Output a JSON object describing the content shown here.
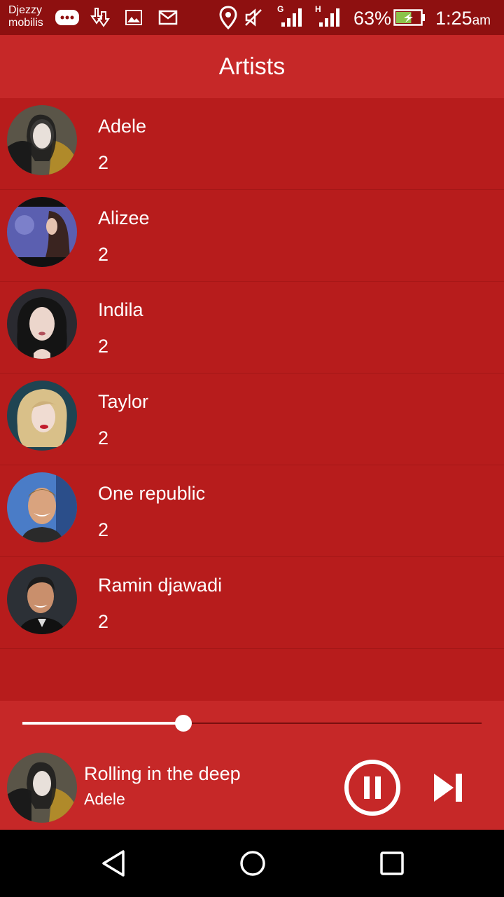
{
  "status_bar": {
    "carrier_line1": "Djezzy",
    "carrier_line2": "mobilis",
    "network_label_1": "G",
    "network_label_2": "H",
    "battery_percent": "63%",
    "time": "1:25",
    "time_suffix": "am",
    "battery_color": "#8bc34a",
    "icons": [
      "chat-icon",
      "download-icon",
      "image-icon",
      "email-icon",
      "location-icon",
      "mute-icon",
      "signal-icon",
      "signal-icon",
      "battery-charging-icon"
    ]
  },
  "app_bar": {
    "title": "Artists",
    "color": "#c62828"
  },
  "artists": [
    {
      "name": "Adele",
      "count": "2"
    },
    {
      "name": "Alizee",
      "count": "2"
    },
    {
      "name": "Indila",
      "count": "2"
    },
    {
      "name": "Taylor",
      "count": "2"
    },
    {
      "name": "One republic",
      "count": "2"
    },
    {
      "name": "Ramin djawadi",
      "count": "2"
    }
  ],
  "player": {
    "track_title": "Rolling in the deep",
    "track_artist": "Adele",
    "progress": 0.35,
    "state_icon": "pause-icon",
    "next_icon": "skip-next-icon"
  },
  "nav_bar": {
    "icons": [
      "back-icon",
      "home-icon",
      "recent-apps-icon"
    ]
  },
  "theme": {
    "primary": "#c62828",
    "list_background": "#b71c1c",
    "status_bar": "#8e1010"
  }
}
